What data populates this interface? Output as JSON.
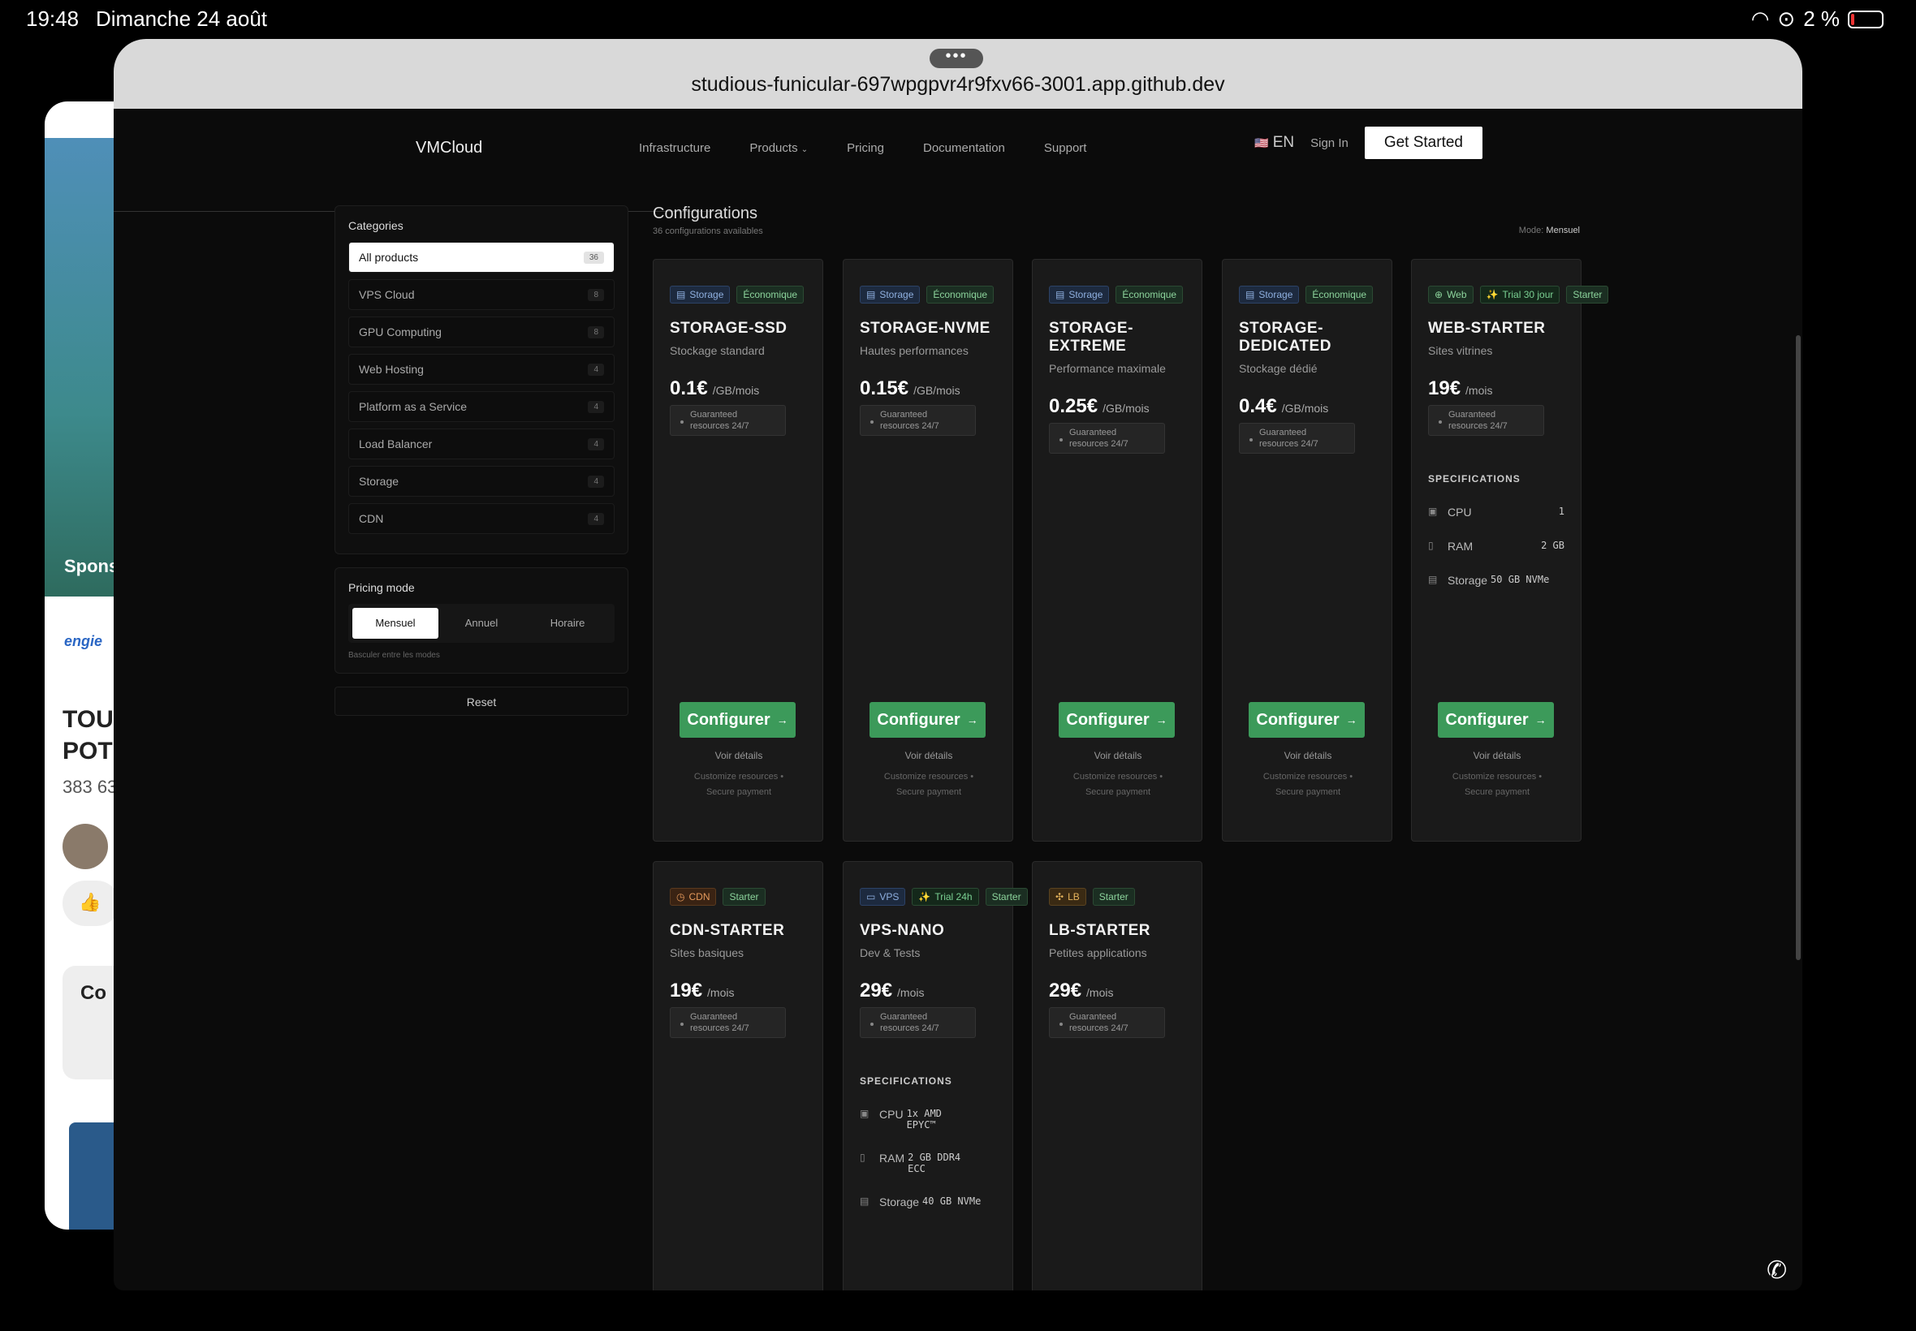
{
  "status": {
    "time": "19:48",
    "date": "Dimanche 24 août",
    "battery": "2 %"
  },
  "background_app": {
    "sponsor": "Spons",
    "brand": "engie",
    "headline1": "TOU",
    "headline2": "POT",
    "count": "383 63",
    "comment": "Co"
  },
  "browser": {
    "url": "studious-funicular-697wpgpvr4r9fxv66-3001.app.github.dev"
  },
  "nav": {
    "logo": "VMCloud",
    "links": [
      "Infrastructure",
      "Products",
      "Pricing",
      "Documentation",
      "Support"
    ],
    "lang": "EN",
    "sign_in": "Sign In",
    "cta": "Get Started"
  },
  "sidebar": {
    "categories_title": "Categories",
    "categories": [
      {
        "label": "All products",
        "count": "36"
      },
      {
        "label": "VPS Cloud",
        "count": "8"
      },
      {
        "label": "GPU Computing",
        "count": "8"
      },
      {
        "label": "Web Hosting",
        "count": "4"
      },
      {
        "label": "Platform as a Service",
        "count": "4"
      },
      {
        "label": "Load Balancer",
        "count": "4"
      },
      {
        "label": "Storage",
        "count": "4"
      },
      {
        "label": "CDN",
        "count": "4"
      }
    ],
    "pricing_title": "Pricing mode",
    "modes": [
      "Mensuel",
      "Annuel",
      "Horaire"
    ],
    "hint": "Basculer entre les modes",
    "reset": "Reset"
  },
  "main": {
    "title": "Configurations",
    "subtitle": "36 configurations availables",
    "mode_label": "Mode:",
    "mode_value": "Mensuel"
  },
  "card_common": {
    "guaranteed": "Guaranteed resources 24/7",
    "configure": "Configurer",
    "details": "Voir détails",
    "footer1": "Customize resources •",
    "footer2": "Secure payment",
    "specs_title": "SPECIFICATIONS"
  },
  "cards": [
    {
      "badges": [
        "Storage",
        "Économique"
      ],
      "name": "STORAGE-SSD",
      "desc": "Stockage standard",
      "price": "0.1€",
      "unit": "/GB/mois"
    },
    {
      "badges": [
        "Storage",
        "Économique"
      ],
      "name": "STORAGE-NVME",
      "desc": "Hautes performances",
      "price": "0.15€",
      "unit": "/GB/mois"
    },
    {
      "badges": [
        "Storage",
        "Économique"
      ],
      "name": "STORAGE-EXTREME",
      "desc": "Performance maximale",
      "price": "0.25€",
      "unit": "/GB/mois"
    },
    {
      "badges": [
        "Storage",
        "Économique"
      ],
      "name": "STORAGE-DEDICATED",
      "desc": "Stockage dédié",
      "price": "0.4€",
      "unit": "/GB/mois"
    },
    {
      "badges": [
        "Web",
        "Trial 30 jour",
        "Starter"
      ],
      "name": "WEB-STARTER",
      "desc": "Sites vitrines",
      "price": "19€",
      "unit": "/mois",
      "specs": [
        {
          "label": "CPU",
          "value": "1"
        },
        {
          "label": "RAM",
          "value": "2 GB"
        },
        {
          "label": "Storage",
          "value": "50 GB NVMe"
        }
      ]
    },
    {
      "badges": [
        "CDN",
        "Starter"
      ],
      "name": "CDN-STARTER",
      "desc": "Sites basiques",
      "price": "19€",
      "unit": "/mois"
    },
    {
      "badges": [
        "VPS",
        "Trial 24h",
        "Starter"
      ],
      "name": "VPS-NANO",
      "desc": "Dev & Tests",
      "price": "29€",
      "unit": "/mois",
      "specs": [
        {
          "label": "CPU",
          "value": "1x AMD EPYC™"
        },
        {
          "label": "RAM",
          "value": "2 GB DDR4 ECC"
        },
        {
          "label": "Storage",
          "value": "40 GB NVMe"
        }
      ]
    },
    {
      "badges": [
        "LB",
        "Starter"
      ],
      "name": "LB-STARTER",
      "desc": "Petites applications",
      "price": "29€",
      "unit": "/mois"
    }
  ]
}
